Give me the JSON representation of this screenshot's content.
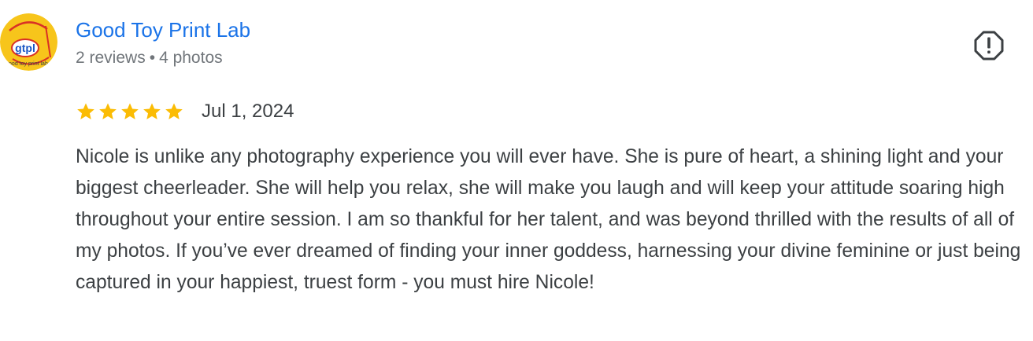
{
  "reviewer": {
    "name": "Good Toy Print Lab",
    "avatar_text": "gtpl",
    "avatar_subtext": "good toy print lab",
    "reviews": "2 reviews",
    "separator": "•",
    "photos": "4 photos"
  },
  "review": {
    "rating": 5,
    "max_rating": 5,
    "date": "Jul 1, 2024",
    "text": "Nicole is unlike any photography experience you will ever have. She is pure of heart, a shining light and your biggest cheerleader. She will help you relax, she will make you laugh and will keep your attitude soaring high throughout your entire session. I am so thankful for her talent, and was beyond thrilled with the results of all of my photos. If you’ve ever dreamed of finding your inner goddess, harnessing your divine feminine or just being captured in your happiest, truest form - you must hire Nicole!"
  },
  "icons": {
    "report": "report-flag-icon",
    "star": "star-icon"
  },
  "colors": {
    "name_link": "#1a73e8",
    "star": "#fbbc04",
    "meta": "#70757a",
    "text": "#3c4043",
    "avatar_bg": "#f7c51b",
    "avatar_accent": "#d93025",
    "avatar_text": "#1a56c4"
  }
}
